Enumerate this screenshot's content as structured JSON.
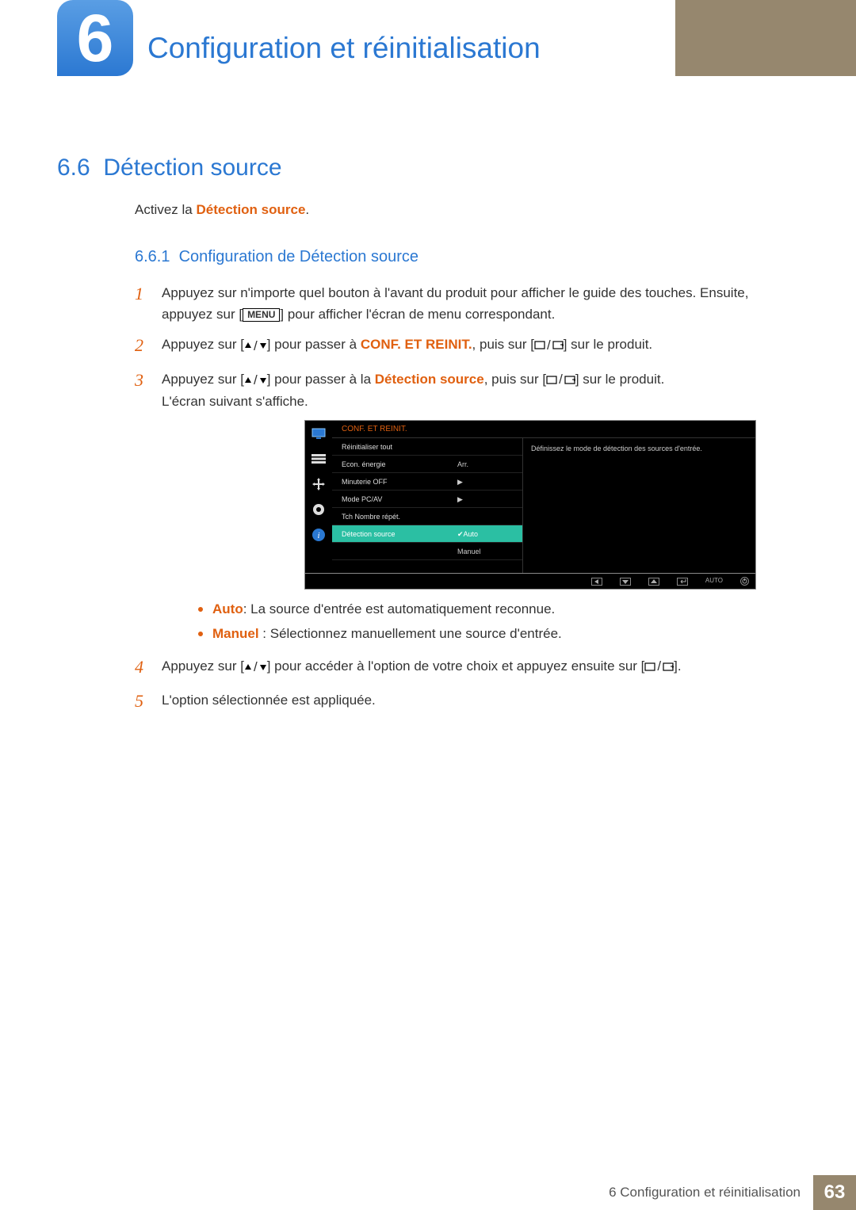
{
  "header": {
    "chapter_number": "6",
    "title": "Configuration et réinitialisation"
  },
  "section": {
    "number": "6.6",
    "title": "Détection source"
  },
  "intro": {
    "prefix": "Activez la ",
    "term": "Détection source",
    "suffix": "."
  },
  "subsection": {
    "number": "6.6.1",
    "title": "Configuration de Détection source"
  },
  "steps": {
    "s1": {
      "num": "1",
      "line1": "Appuyez sur n'importe quel bouton à l'avant du produit pour afficher le guide des touches. Ensuite,",
      "line2_a": "appuyez sur [",
      "menu": "MENU",
      "line2_b": "] pour afficher l'écran de menu correspondant."
    },
    "s2": {
      "num": "2",
      "a": "Appuyez sur [",
      "b": "] pour passer à ",
      "conf": "CONF. ET REINIT.",
      "c": ", puis sur [",
      "d": "] sur le produit."
    },
    "s3": {
      "num": "3",
      "a": "Appuyez sur [",
      "b": "] pour passer à la ",
      "term": "Détection source",
      "c": ", puis sur [",
      "d": "] sur le produit.",
      "line2": "L'écran suivant s'affiche."
    },
    "s4": {
      "num": "4",
      "a": "Appuyez sur [",
      "b": "] pour accéder à l'option de votre choix et appuyez ensuite sur [",
      "c": "]."
    },
    "s5": {
      "num": "5",
      "text": "L'option sélectionnée est appliquée."
    }
  },
  "osd": {
    "header": "CONF. ET REINIT.",
    "desc": "Définissez le mode de détection des sources d'entrée.",
    "rows": [
      {
        "label": "Réinitialiser tout",
        "value": ""
      },
      {
        "label": "Econ. énergie",
        "value": "Arr."
      },
      {
        "label": "Minuterie OFF",
        "value": "▶"
      },
      {
        "label": "Mode PC/AV",
        "value": "▶"
      },
      {
        "label": "Tch Nombre répét.",
        "value": ""
      },
      {
        "label": "Détection source",
        "value": "Auto",
        "selected": true
      },
      {
        "label": "",
        "value": "Manuel"
      }
    ],
    "footer_auto": "AUTO"
  },
  "bullets": {
    "auto": {
      "term": "Auto",
      "text": ": La source d'entrée est automatiquement reconnue."
    },
    "manuel": {
      "term": "Manuel",
      "text": " : Sélectionnez manuellement une source d'entrée."
    }
  },
  "footer": {
    "text": "6 Configuration et réinitialisation",
    "page": "63"
  }
}
